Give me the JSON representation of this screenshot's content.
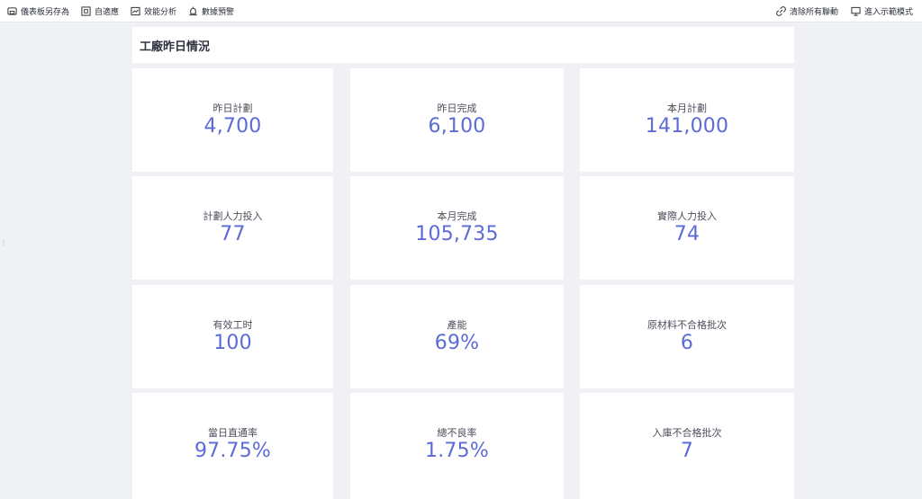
{
  "toolbar": {
    "left": [
      {
        "label": "儀表板另存為",
        "icon": "save-as-icon"
      },
      {
        "label": "自適應",
        "icon": "fit-screen-icon"
      },
      {
        "label": "效能分析",
        "icon": "performance-icon"
      },
      {
        "label": "數據預警",
        "icon": "alert-icon"
      }
    ],
    "right": [
      {
        "label": "清除所有聯動",
        "icon": "clear-link-icon"
      },
      {
        "label": "進入示範模式",
        "icon": "presentation-icon"
      }
    ]
  },
  "section": {
    "title": "工廠昨日情況"
  },
  "cards": [
    {
      "label": "昨日計劃",
      "value": "4,700"
    },
    {
      "label": "昨日完成",
      "value": "6,100"
    },
    {
      "label": "本月計劃",
      "value": "141,000"
    },
    {
      "label": "計劃人力投入",
      "value": "77"
    },
    {
      "label": "本月完成",
      "value": "105,735"
    },
    {
      "label": "實際人力投入",
      "value": "74"
    },
    {
      "label": "有效工时",
      "value": "100"
    },
    {
      "label": "產能",
      "value": "69%"
    },
    {
      "label": "原材料不合格批次",
      "value": "6"
    },
    {
      "label": "當日直通率",
      "value": "97.75%"
    },
    {
      "label": "總不良率",
      "value": "1.75%"
    },
    {
      "label": "入庫不合格批次",
      "value": "7"
    }
  ],
  "colors": {
    "accent": "#5c6bd6",
    "background": "#f0f1f5",
    "card": "#ffffff"
  }
}
